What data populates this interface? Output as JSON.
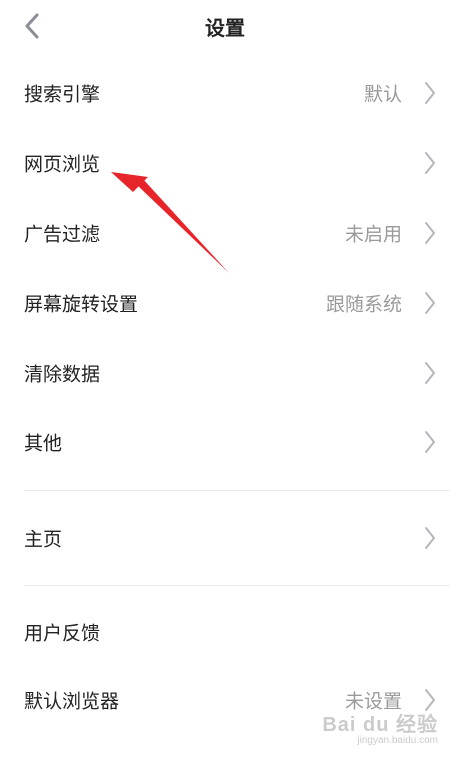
{
  "header": {
    "title": "设置",
    "back_icon": "chevron-left-icon"
  },
  "settings": {
    "items": [
      {
        "label": "搜索引擎",
        "value": "默认"
      },
      {
        "label": "网页浏览",
        "value": ""
      },
      {
        "label": "广告过滤",
        "value": "未启用"
      },
      {
        "label": "屏幕旋转设置",
        "value": "跟随系统"
      },
      {
        "label": "清除数据",
        "value": ""
      },
      {
        "label": "其他",
        "value": ""
      }
    ],
    "group2": [
      {
        "label": "主页",
        "value": ""
      }
    ],
    "group3": [
      {
        "label": "用户反馈",
        "value": ""
      },
      {
        "label": "默认浏览器",
        "value": "未设置"
      }
    ]
  },
  "colors": {
    "label": "#222222",
    "value": "#9a9a9a",
    "chevron": "#b5b5be",
    "annotation_arrow": "#e8242b",
    "divider": "#ececec"
  },
  "watermark": {
    "main": "Bai du 经验",
    "sub": "jingyan.baidu.com"
  }
}
